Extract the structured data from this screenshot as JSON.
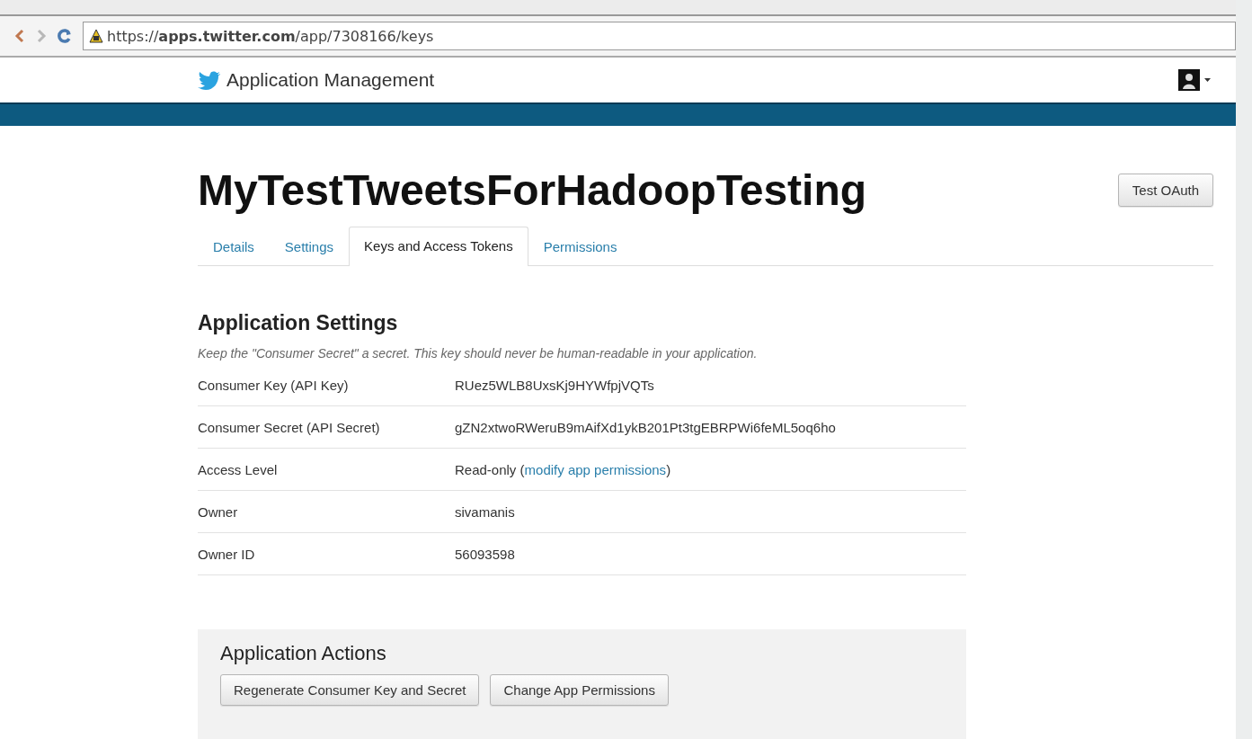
{
  "browser": {
    "url": "https://**apps.twitter.com**/app/7308166/keys"
  },
  "header": {
    "title": "Application Management"
  },
  "app": {
    "name": "MyTestTweetsForHadoopTesting",
    "action": "Test OAuth"
  },
  "tabs": [
    {
      "label": "Details",
      "selected": false
    },
    {
      "label": "Settings",
      "selected": false
    },
    {
      "label": "Keys and Access Tokens",
      "selected": true
    },
    {
      "label": "Permissions",
      "selected": false
    }
  ],
  "settings": {
    "heading": "Application Settings",
    "note": "Keep the \"Consumer Secret\" a secret. This key should never be human-readable in your application.",
    "rows": [
      {
        "label": "Consumer Key (API Key)",
        "value": "RUez5WLB8UxsKj9HYWfpjVQTs"
      },
      {
        "label": "Consumer Secret (API Secret)",
        "value": "gZN2xtwoRWeruB9mAifXd1ykB201Pt3tgEBRPWi6feML5oq6ho"
      },
      {
        "label": "Access Level",
        "value": "Read-only (",
        "link": "modify app permissions",
        "suffix": ")"
      },
      {
        "label": "Owner",
        "value": "sivamanis"
      },
      {
        "label": "Owner ID",
        "value": "56093598"
      }
    ]
  },
  "actions": {
    "heading": "Application Actions",
    "buttons": [
      "Regenerate Consumer Key and Secret",
      "Change App Permissions"
    ]
  }
}
